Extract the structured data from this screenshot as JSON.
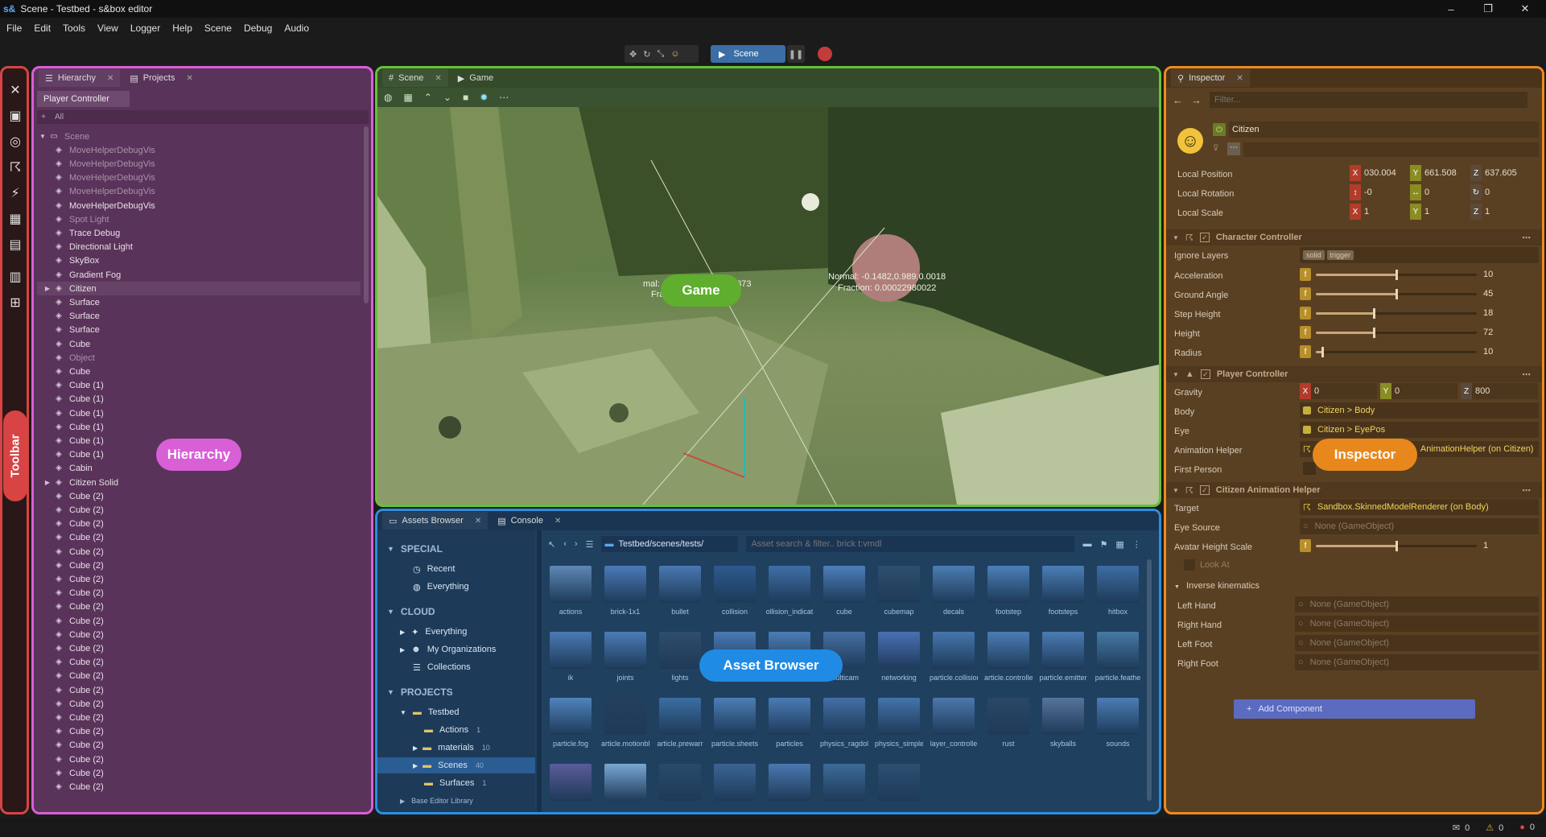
{
  "window": {
    "app_logo": "s&",
    "title": "Scene - Testbed - s&box editor",
    "minimize": "–",
    "maximize": "❐",
    "close": "✕"
  },
  "menu": [
    "File",
    "Edit",
    "Tools",
    "View",
    "Logger",
    "Help",
    "Scene",
    "Debug",
    "Audio"
  ],
  "playbar": {
    "play_label": "Scene",
    "pause_icon": "pause-icon",
    "stop_icon": "stop-icon"
  },
  "labels": {
    "toolbar": "Toolbar",
    "hierarchy": "Hierarchy",
    "game": "Game",
    "asset_browser": "Asset Browser",
    "inspector": "Inspector"
  },
  "colors": {
    "toolbar": "#d84343",
    "hierarchy": "#d85fd6",
    "game": "#66c13a",
    "asset_browser": "#2c8fe0",
    "inspector": "#ee8a21"
  },
  "hierarchy": {
    "tabs": [
      {
        "label": "Hierarchy"
      },
      {
        "label": "Projects"
      }
    ],
    "selected_object": "Player Controller",
    "filter_placeholder": "All",
    "root": "Scene",
    "rows": [
      {
        "label": "MoveHelperDebugVis",
        "dim": true
      },
      {
        "label": "MoveHelperDebugVis",
        "dim": true
      },
      {
        "label": "MoveHelperDebugVis",
        "dim": true
      },
      {
        "label": "MoveHelperDebugVis",
        "dim": true
      },
      {
        "label": "MoveHelperDebugVis",
        "dim": false
      },
      {
        "label": "Spot Light",
        "dim": true
      },
      {
        "label": "Trace Debug",
        "dim": false
      },
      {
        "label": "Directional Light",
        "dim": false
      },
      {
        "label": "SkyBox",
        "dim": false
      },
      {
        "label": "Gradient Fog",
        "dim": false
      },
      {
        "label": "Citizen",
        "dim": false,
        "expandable": true,
        "selected": true
      },
      {
        "label": "Surface",
        "dim": false
      },
      {
        "label": "Surface",
        "dim": false
      },
      {
        "label": "Surface",
        "dim": false
      },
      {
        "label": "Cube",
        "dim": false
      },
      {
        "label": "Object",
        "dim": true
      },
      {
        "label": "Cube",
        "dim": false
      },
      {
        "label": "Cube (1)",
        "dim": false
      },
      {
        "label": "Cube (1)",
        "dim": false
      },
      {
        "label": "Cube (1)",
        "dim": false
      },
      {
        "label": "Cube (1)",
        "dim": false
      },
      {
        "label": "Cube (1)",
        "dim": false
      },
      {
        "label": "Cube (1)",
        "dim": false
      },
      {
        "label": "Cabin",
        "dim": false
      },
      {
        "label": "Citizen Solid",
        "dim": false,
        "expandable": true
      },
      {
        "label": "Cube (2)",
        "dim": false
      },
      {
        "label": "Cube (2)",
        "dim": false
      },
      {
        "label": "Cube (2)",
        "dim": false
      },
      {
        "label": "Cube (2)",
        "dim": false
      },
      {
        "label": "Cube (2)",
        "dim": false
      },
      {
        "label": "Cube (2)",
        "dim": false
      },
      {
        "label": "Cube (2)",
        "dim": false
      },
      {
        "label": "Cube (2)",
        "dim": false
      },
      {
        "label": "Cube (2)",
        "dim": false
      },
      {
        "label": "Cube (2)",
        "dim": false
      },
      {
        "label": "Cube (2)",
        "dim": false
      },
      {
        "label": "Cube (2)",
        "dim": false
      },
      {
        "label": "Cube (2)",
        "dim": false
      },
      {
        "label": "Cube (2)",
        "dim": false
      },
      {
        "label": "Cube (2)",
        "dim": false
      },
      {
        "label": "Cube (2)",
        "dim": false
      },
      {
        "label": "Cube (2)",
        "dim": false
      },
      {
        "label": "Cube (2)",
        "dim": false
      },
      {
        "label": "Cube (2)",
        "dim": false
      },
      {
        "label": "Cube (2)",
        "dim": false
      },
      {
        "label": "Cube (2)",
        "dim": false
      },
      {
        "label": "Cube (2)",
        "dim": false
      }
    ]
  },
  "scene": {
    "tabs": [
      {
        "label": "Scene"
      },
      {
        "label": "Game"
      }
    ],
    "overlay_left": {
      "line1": "mal: -0.4613,0.7414,0.4873",
      "line2": "Fraction: 0.07470599"
    },
    "overlay_right": {
      "line1": "Normal: -0.1482,0.989,0.0018",
      "line2": "Fraction: 0.00022980022"
    }
  },
  "assets": {
    "tabs": [
      {
        "label": "Assets Browser"
      },
      {
        "label": "Console"
      }
    ],
    "path": "Testbed/scenes/tests/",
    "search_placeholder": "Asset search & filter.. brick t:vmdl",
    "tree": {
      "special_header": "SPECIAL",
      "special": [
        {
          "label": "Recent"
        },
        {
          "label": "Everything"
        }
      ],
      "cloud_header": "CLOUD",
      "cloud": [
        {
          "label": "Everything"
        },
        {
          "label": "My Organizations"
        },
        {
          "label": "Collections"
        }
      ],
      "projects_header": "PROJECTS",
      "project": "Testbed",
      "folders": [
        {
          "label": "Actions",
          "count": "1"
        },
        {
          "label": "materials",
          "count": "10"
        },
        {
          "label": "Scenes",
          "count": "40",
          "selected": true
        },
        {
          "label": "Surfaces",
          "count": "1"
        }
      ],
      "more": "Base Editor Library"
    },
    "grid": [
      {
        "label": "actions",
        "color": "#5e88b5"
      },
      {
        "label": "brick-1x1",
        "color": "#4a7ab8"
      },
      {
        "label": "bullet",
        "color": "#4a78b2"
      },
      {
        "label": "collision",
        "color": "#2d5a8f"
      },
      {
        "label": "ollision_indicat",
        "color": "#3f6fa8"
      },
      {
        "label": "cube",
        "color": "#4d7fbb"
      },
      {
        "label": "cubemap",
        "color": "#2e506e"
      },
      {
        "label": "decals",
        "color": "#4b7db3"
      },
      {
        "label": "footstep",
        "color": "#4a80b9"
      },
      {
        "label": "footsteps",
        "color": "#4a7eb6"
      },
      {
        "label": "hitbox",
        "color": "#3d6ea5"
      },
      {
        "label": "ik",
        "color": "#4a7ab5"
      },
      {
        "label": "joints",
        "color": "#4b7cb6"
      },
      {
        "label": "lights",
        "color": "#2f4d6c"
      },
      {
        "label": "loading",
        "color": "#4a7ab5"
      },
      {
        "label": "menu",
        "color": "#4b7db6"
      },
      {
        "label": "multicam",
        "color": "#456fa2"
      },
      {
        "label": "networking",
        "color": "#4a70b5"
      },
      {
        "label": "particle.collisior",
        "color": "#4576ae"
      },
      {
        "label": "article.controlle",
        "color": "#4b7db5"
      },
      {
        "label": "particle.emitter",
        "color": "#4a7cb4"
      },
      {
        "label": "particle.feathe",
        "color": "#457aa5"
      },
      {
        "label": "particle.fog",
        "color": "#4f84bd"
      },
      {
        "label": "article.motionbl",
        "color": "#243f5d"
      },
      {
        "label": "article.prewarr",
        "color": "#3b6ea3"
      },
      {
        "label": "particle.sheets",
        "color": "#4b7eb7"
      },
      {
        "label": "particles",
        "color": "#4a7bb5"
      },
      {
        "label": "physics_ragdol",
        "color": "#436fa6"
      },
      {
        "label": "physics_simple",
        "color": "#4374aa"
      },
      {
        "label": "layer_controlle",
        "color": "#4c78ad"
      },
      {
        "label": "rust",
        "color": "#2a4866"
      },
      {
        "label": "skyballs",
        "color": "#56739b"
      },
      {
        "label": "sounds",
        "color": "#4b7db6"
      },
      {
        "label": "",
        "color": "#5a5c9a"
      },
      {
        "label": "",
        "color": "#7aa7d4"
      },
      {
        "label": "",
        "color": "#2a4a6c"
      },
      {
        "label": "",
        "color": "#3a6495"
      },
      {
        "label": "",
        "color": "#4a78b0"
      },
      {
        "label": "",
        "color": "#3c6b98"
      },
      {
        "label": "",
        "color": "#2d4f72"
      }
    ]
  },
  "inspector": {
    "tab": "Inspector",
    "filter_placeholder": "Filter...",
    "object_name": "Citizen",
    "transform": {
      "position_label": "Local Position",
      "position": [
        "030.004",
        "661.508",
        "637.605"
      ],
      "rotation_label": "Local Rotation",
      "rotation": [
        "-0",
        "0",
        "0"
      ],
      "scale_label": "Local Scale",
      "scale": [
        "1",
        "1",
        "1"
      ],
      "x": "X",
      "y": "Y",
      "z": "Z"
    },
    "character_controller": {
      "title": "Character Controller",
      "ignore_layers_label": "Ignore Layers",
      "ignore_tags": [
        "solid",
        "trigger"
      ],
      "f": "f",
      "fields": [
        {
          "label": "Acceleration",
          "value": "10",
          "fraction": 0.5
        },
        {
          "label": "Ground Angle",
          "value": "45",
          "fraction": 0.5
        },
        {
          "label": "Step Height",
          "value": "18",
          "fraction": 0.36
        },
        {
          "label": "Height",
          "value": "72",
          "fraction": 0.36
        },
        {
          "label": "Radius",
          "value": "10",
          "fraction": 0.04
        }
      ]
    },
    "player_controller": {
      "title": "Player Controller",
      "gravity_label": "Gravity",
      "gravity": [
        "0",
        "0",
        "800"
      ],
      "body_label": "Body",
      "body_value": "Citizen > Body",
      "eye_label": "Eye",
      "eye_value": "Citizen > EyePos",
      "anim_label": "Animation Helper",
      "anim_value": "AnimationHelper (on Citizen)",
      "first_person_label": "First Person"
    },
    "citizen_anim": {
      "title": "Citizen Animation Helper",
      "target_label": "Target",
      "target_value": "Sandbox.SkinnedModelRenderer (on Body)",
      "eye_source_label": "Eye Source",
      "eye_source_value": "None (GameObject)",
      "avatar_label": "Avatar Height Scale",
      "avatar_value": "1",
      "avatar_fraction": 0.5,
      "look_at_label": "Look At",
      "ik_label": "Inverse kinematics",
      "ik_rows": [
        {
          "label": "Left Hand",
          "value": "None (GameObject)"
        },
        {
          "label": "Right Hand",
          "value": "None (GameObject)"
        },
        {
          "label": "Left Foot",
          "value": "None (GameObject)"
        },
        {
          "label": "Right Foot",
          "value": "None (GameObject)"
        }
      ]
    },
    "add_component": "Add Component"
  },
  "status": {
    "messages": "0",
    "warnings": "0",
    "errors": "0"
  }
}
